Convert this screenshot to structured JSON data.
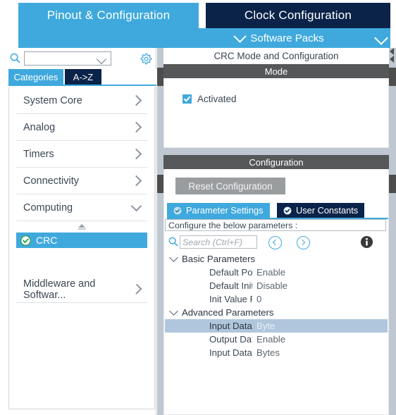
{
  "topbar": {
    "tabs": [
      {
        "label": "Pinout & Configuration",
        "active": true
      },
      {
        "label": "Clock Configuration",
        "active": false
      }
    ]
  },
  "software_packs": {
    "label": "Software Packs"
  },
  "sidebar": {
    "search": {
      "value": "",
      "placeholder": ""
    },
    "gear_icon": "gear-icon",
    "view_tabs": [
      {
        "label": "Categories",
        "active": true
      },
      {
        "label": "A->Z",
        "active": false
      }
    ],
    "categories": [
      {
        "label": "System Core",
        "expanded": false
      },
      {
        "label": "Analog",
        "expanded": false
      },
      {
        "label": "Timers",
        "expanded": false
      },
      {
        "label": "Connectivity",
        "expanded": false
      },
      {
        "label": "Computing",
        "expanded": true
      }
    ],
    "peripherals": [
      {
        "label": "CRC",
        "selected": true,
        "status": "configured"
      }
    ],
    "categories_after": [
      {
        "label": "Middleware and Softwar...",
        "expanded": false
      }
    ]
  },
  "right_panel": {
    "title": "CRC Mode and Configuration",
    "mode": {
      "header": "Mode",
      "checkbox": {
        "label": "Activated",
        "checked": true
      }
    },
    "configuration": {
      "header": "Configuration",
      "reset_button": "Reset Configuration",
      "tabs": [
        {
          "label": "Parameter Settings",
          "active": true
        },
        {
          "label": "User Constants",
          "active": false
        }
      ],
      "hint": "Configure the below parameters :",
      "search": {
        "value": "",
        "placeholder": "Search (Ctrl+F)"
      },
      "nav_prev_icon": "chevron-left-circle-icon",
      "nav_next_icon": "chevron-right-circle-icon",
      "info_icon": "info-icon",
      "tree": [
        {
          "group": "Basic Parameters",
          "expanded": true,
          "rows": [
            {
              "name": "Default Polyn...",
              "value": "Enable",
              "selected": false
            },
            {
              "name": "Default Init V...",
              "value": "Disable",
              "selected": false
            },
            {
              "name": "Init Value For...",
              "value": "0",
              "selected": false
            }
          ]
        },
        {
          "group": "Advanced Parameters",
          "expanded": true,
          "rows": [
            {
              "name": "Input Data Inv...",
              "value": "Byte",
              "selected": true
            },
            {
              "name": "Output Data I...",
              "value": "Enable",
              "selected": false
            },
            {
              "name": "Input Data Fo...",
              "value": "Bytes",
              "selected": false
            }
          ]
        }
      ]
    }
  },
  "colors": {
    "accent_blue": "#3fa9dd",
    "dark_navy": "#0b2349",
    "section_gray": "#555759",
    "selection_row": "#b0c6dd",
    "button_gray": "#9a9da0",
    "splitter": "#bfc8d1",
    "check_green": "#4caf50"
  }
}
